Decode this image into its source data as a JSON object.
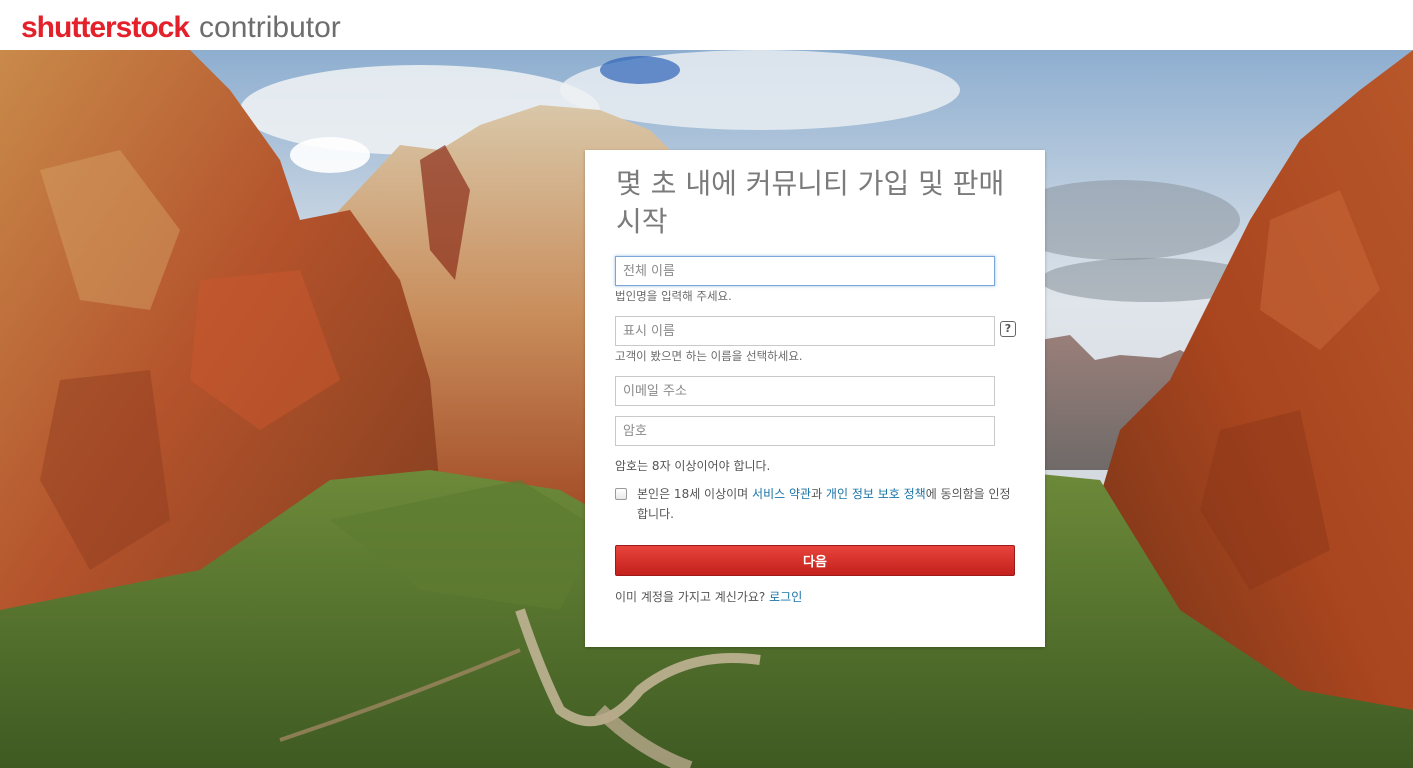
{
  "header": {
    "logo_brand": "shutterstock",
    "logo_product": "contributor"
  },
  "signup": {
    "title": "몇 초 내에 커뮤니티 가입 및 판매 시작",
    "full_name": {
      "value": "",
      "placeholder": "전체 이름",
      "hint": "법인명을 입력해 주세요."
    },
    "display_name": {
      "value": "",
      "placeholder": "표시 이름",
      "hint": "고객이 봤으면 하는 이름을 선택하세요.",
      "help_label": "?"
    },
    "email": {
      "value": "",
      "placeholder": "이메일 주소"
    },
    "password": {
      "value": "",
      "placeholder": "암호"
    },
    "password_note": "암호는 8자 이상이어야 합니다.",
    "consent": {
      "checked": false,
      "text_before": "본인은 18세 이상이며 ",
      "terms_link": "서비스 약관",
      "text_middle": "과 ",
      "privacy_link": "개인 정보 보호 정책",
      "text_after": "에 동의함을 인정합니다."
    },
    "next_button": "다음",
    "login_prompt": "이미 계정을 가지고 계신가요? ",
    "login_link": "로그인"
  },
  "colors": {
    "brand_red": "#e4202a",
    "button_red": "#d0302a",
    "link_blue": "#1a73a8",
    "sky": "#c9d3dc",
    "rock": "#b5532b",
    "vegetation": "#4f6b2a"
  },
  "icons": [
    "help-icon"
  ]
}
